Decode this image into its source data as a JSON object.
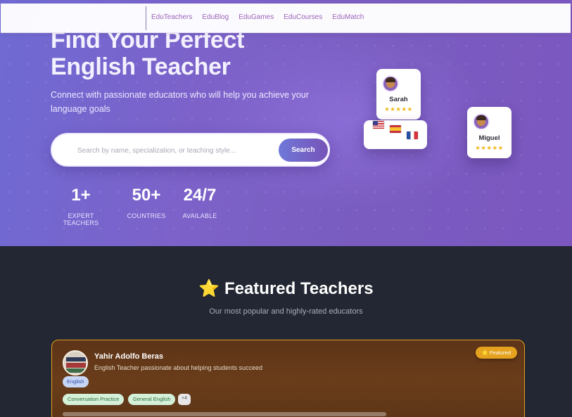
{
  "nav": {
    "links": [
      "EduTeachers",
      "EduBlog",
      "EduGames",
      "EduCourses",
      "EduMatch"
    ]
  },
  "hero": {
    "title_line1": "Find Your Perfect",
    "title_line2": "English Teacher",
    "subtitle": "Connect with passionate educators who will help you achieve your language goals",
    "search_placeholder": "Search by name, specialization, or teaching style...",
    "search_button": "Search",
    "stats": [
      {
        "value": "1+",
        "label": "EXPERT TEACHERS"
      },
      {
        "value": "50+",
        "label": "COUNTRIES"
      },
      {
        "value": "24/7",
        "label": "AVAILABLE"
      }
    ],
    "floating_cards": {
      "sarah": {
        "name": "Sarah",
        "stars": "★★★★★"
      },
      "miguel": {
        "name": "Miguel",
        "stars": "★★★★★"
      },
      "flags": [
        "us-flag",
        "spain-flag",
        "france-flag"
      ]
    }
  },
  "featured": {
    "icon": "⭐",
    "title": "Featured Teachers",
    "subtitle": "Our most popular and highly-rated educators",
    "teacher": {
      "name": "Yahir Adolfo Beras",
      "description": "English Teacher passionate about helping students succeed",
      "badge": "⭐ Featured",
      "language": "English",
      "tags": [
        "Conversation Practice",
        "General English"
      ],
      "more": "+4"
    }
  },
  "colors": {
    "hero_start": "#6f6ad3",
    "hero_end": "#7b57bf",
    "dark_bg": "#222733",
    "accent_gold": "#e4a21e",
    "nav_link": "#9a64b8"
  }
}
